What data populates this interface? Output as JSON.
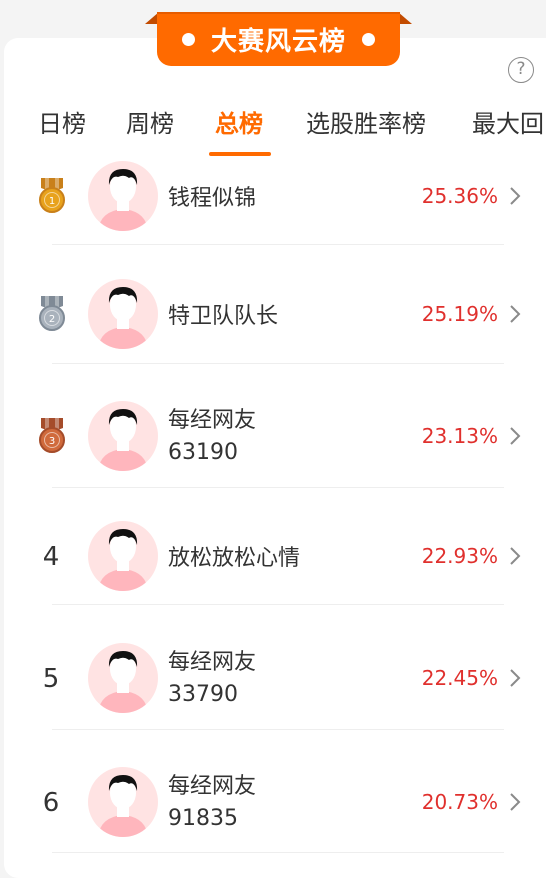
{
  "header": {
    "title": "大赛风云榜",
    "help_label": "?"
  },
  "tabs": [
    {
      "label": "日榜"
    },
    {
      "label": "周榜"
    },
    {
      "label": "总榜"
    },
    {
      "label": "选股胜率榜"
    },
    {
      "label": "最大回"
    }
  ],
  "active_tab": "总榜",
  "colors": {
    "accent": "#ff6a00",
    "percent": "#e0302d",
    "gold": "#e8a21c",
    "silver": "#a9b2bc",
    "bronze": "#d06a3c"
  },
  "rows": [
    {
      "rank": "1",
      "name": "钱程似锦",
      "name_line2": "",
      "pct": "25.36%",
      "badge": "gold-medal-icon"
    },
    {
      "rank": "2",
      "name": "特卫队队长",
      "name_line2": "",
      "pct": "25.19%",
      "badge": "silver-medal-icon"
    },
    {
      "rank": "3",
      "name": "每经网友",
      "name_line2": "63190",
      "pct": "23.13%",
      "badge": "bronze-medal-icon"
    },
    {
      "rank": "4",
      "name": "放松放松心情",
      "name_line2": "",
      "pct": "22.93%",
      "badge": ""
    },
    {
      "rank": "5",
      "name": "每经网友",
      "name_line2": "33790",
      "pct": "22.45%",
      "badge": ""
    },
    {
      "rank": "6",
      "name": "每经网友",
      "name_line2": "91835",
      "pct": "20.73%",
      "badge": ""
    }
  ]
}
